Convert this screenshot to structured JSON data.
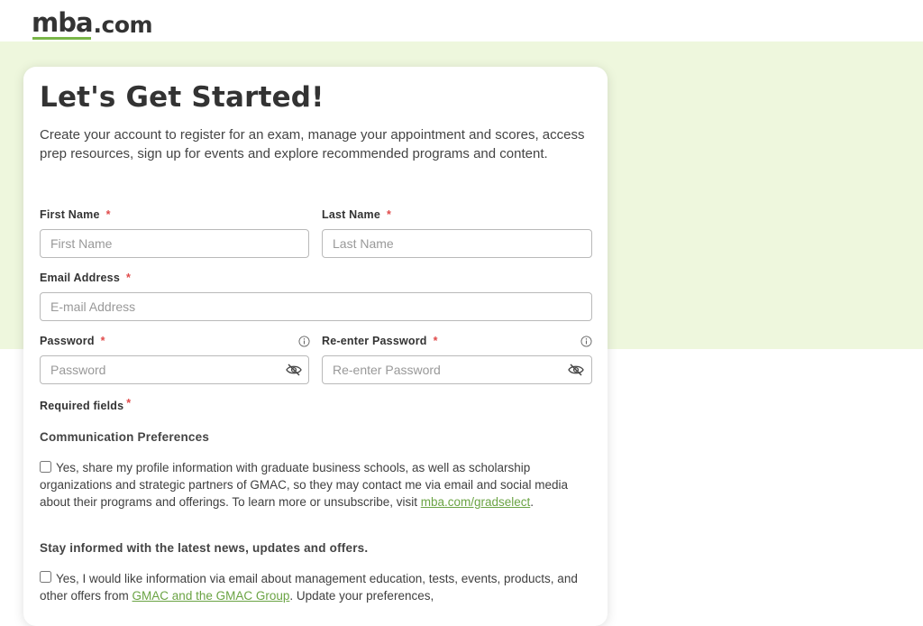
{
  "header": {
    "logo_mba": "mba",
    "logo_dotcom": ".com"
  },
  "form": {
    "title": "Let's Get Started!",
    "intro": "Create your account to register for an exam, manage your appointment and scores, access prep resources, sign up for events and explore recommended programs and content.",
    "required_marker": "*",
    "first_name": {
      "label": "First Name",
      "placeholder": "First Name",
      "value": ""
    },
    "last_name": {
      "label": "Last Name",
      "placeholder": "Last Name",
      "value": ""
    },
    "email": {
      "label": "Email Address",
      "placeholder": "E-mail Address",
      "value": ""
    },
    "password": {
      "label": "Password",
      "placeholder": "Password",
      "value": ""
    },
    "reenter_password": {
      "label": "Re-enter Password",
      "placeholder": "Re-enter Password",
      "value": ""
    },
    "required_fields": "Required fields"
  },
  "preferences": {
    "heading": "Communication Preferences",
    "gradselect": {
      "checked": false,
      "text": "Yes, share my profile information with graduate business schools, as well as scholarship organizations and strategic partners of GMAC, so they may contact me via email and social media about their programs and offerings. To learn more or unsubscribe, visit ",
      "link": "mba.com/gradselect",
      "after": "."
    },
    "news_heading": "Stay informed with the latest news, updates and offers.",
    "news": {
      "checked": false,
      "text": "Yes, I would like information via email about management education, tests, events, products, and other offers from ",
      "link": "GMAC and the GMAC Group",
      "after": ". Update your preferences,"
    }
  },
  "icons": {
    "info": "info-circle-icon",
    "eye": "eye-slash-icon"
  },
  "colors": {
    "brand_green": "#7ab648",
    "band_background": "#eef7dd",
    "link_green": "#6aa343",
    "required_red": "#e04a4a"
  }
}
